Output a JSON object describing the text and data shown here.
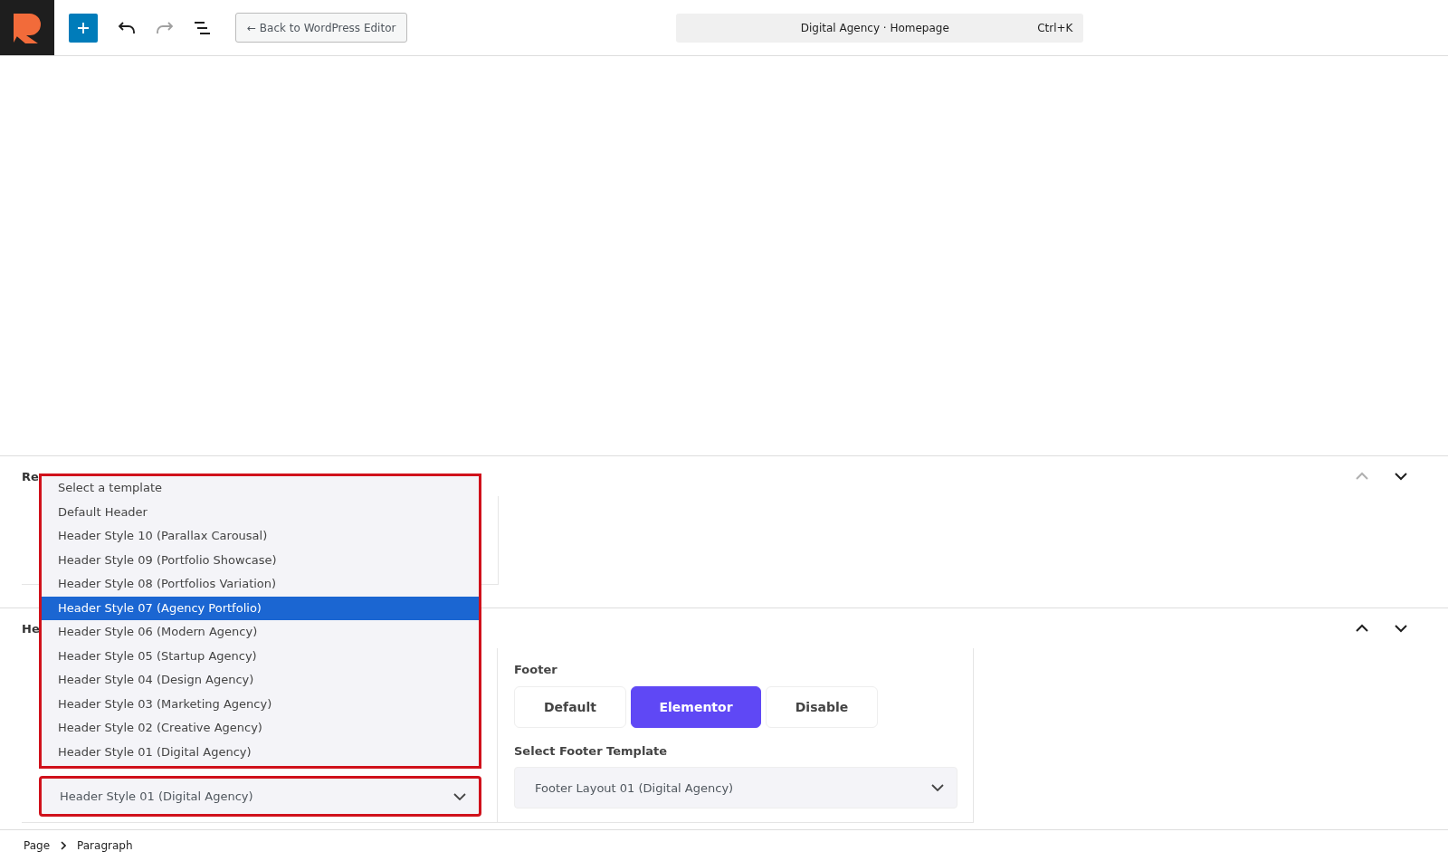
{
  "toolbar": {
    "back_button": "← Back to WordPress Editor",
    "redo_disabled": true,
    "command_bar": {
      "title": "Digital Agency · Homepage",
      "shortcut": "Ctrl+K"
    }
  },
  "panels": [
    {
      "title": "Re",
      "up_disabled": true,
      "down_disabled": false
    },
    {
      "title": "He",
      "up_disabled": false,
      "down_disabled": false
    }
  ],
  "header_dropdown": {
    "options": [
      {
        "label": "Select a template",
        "highlighted": false
      },
      {
        "label": "Default Header",
        "highlighted": false
      },
      {
        "label": "Header Style 10 (Parallax Carousal)",
        "highlighted": false
      },
      {
        "label": "Header Style 09 (Portfolio Showcase)",
        "highlighted": false
      },
      {
        "label": "Header Style 08 (Portfolios Variation)",
        "highlighted": false
      },
      {
        "label": "Header Style 07 (Agency Portfolio)",
        "highlighted": true
      },
      {
        "label": "Header Style 06 (Modern Agency)",
        "highlighted": false
      },
      {
        "label": "Header Style 05 (Startup Agency)",
        "highlighted": false
      },
      {
        "label": "Header Style 04 (Design Agency)",
        "highlighted": false
      },
      {
        "label": "Header Style 03 (Marketing Agency)",
        "highlighted": false
      },
      {
        "label": "Header Style 02 (Creative Agency)",
        "highlighted": false
      },
      {
        "label": "Header Style 01 (Digital Agency)",
        "highlighted": false
      }
    ],
    "value": "Header Style 01 (Digital Agency)"
  },
  "footer": {
    "label": "Footer",
    "options": [
      {
        "label": "Default",
        "selected": false
      },
      {
        "label": "Elementor",
        "selected": true
      },
      {
        "label": "Disable",
        "selected": false
      }
    ],
    "template_label": "Select Footer Template",
    "template_value": "Footer Layout 01 (Digital Agency)"
  },
  "breadcrumb": [
    "Page",
    "Paragraph"
  ]
}
